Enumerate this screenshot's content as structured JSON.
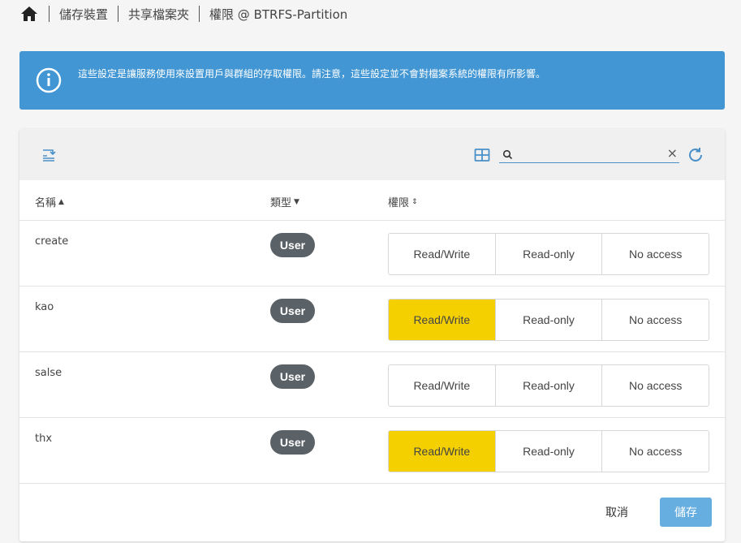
{
  "breadcrumb": {
    "home_icon": "home-icon",
    "items": [
      "儲存裝置",
      "共享檔案夾",
      "權限 @ BTRFS-Partition"
    ]
  },
  "banner": {
    "icon": "info-icon",
    "message": "這些設定是讓服務使用來設置用戶與群組的存取權限。請注意，這些設定並不會對檔案系統的權限有所影響。",
    "color": "#4196d3"
  },
  "toolbar": {
    "left_icon": "list-filter-icon",
    "grid_icon": "grid-view-icon",
    "search": {
      "value": "",
      "placeholder": ""
    },
    "clear_label": "×",
    "refresh_icon": "refresh-icon"
  },
  "table": {
    "headers": {
      "name": "名稱",
      "name_sort": "⌃",
      "type": "類型",
      "type_sort": "⌄",
      "perm": "權限",
      "perm_sort": "⇕"
    },
    "rows": [
      {
        "name": "create",
        "type": "User",
        "perms": [
          "Read/Write",
          "Read-only",
          "No access"
        ],
        "selected": -1
      },
      {
        "name": "kao",
        "type": "User",
        "perms": [
          "Read/Write",
          "Read-only",
          "No access"
        ],
        "selected": 0
      },
      {
        "name": "salse",
        "type": "User",
        "perms": [
          "Read/Write",
          "Read-only",
          "No access"
        ],
        "selected": -1
      },
      {
        "name": "thx",
        "type": "User",
        "perms": [
          "Read/Write",
          "Read-only",
          "No access"
        ],
        "selected": 0
      }
    ]
  },
  "footer": {
    "cancel_label": "取消",
    "save_label": "儲存"
  },
  "colors": {
    "accent": "#4196d3",
    "active_perm": "#f5d000",
    "badge": "#5a6268",
    "save": "#66ade0"
  }
}
